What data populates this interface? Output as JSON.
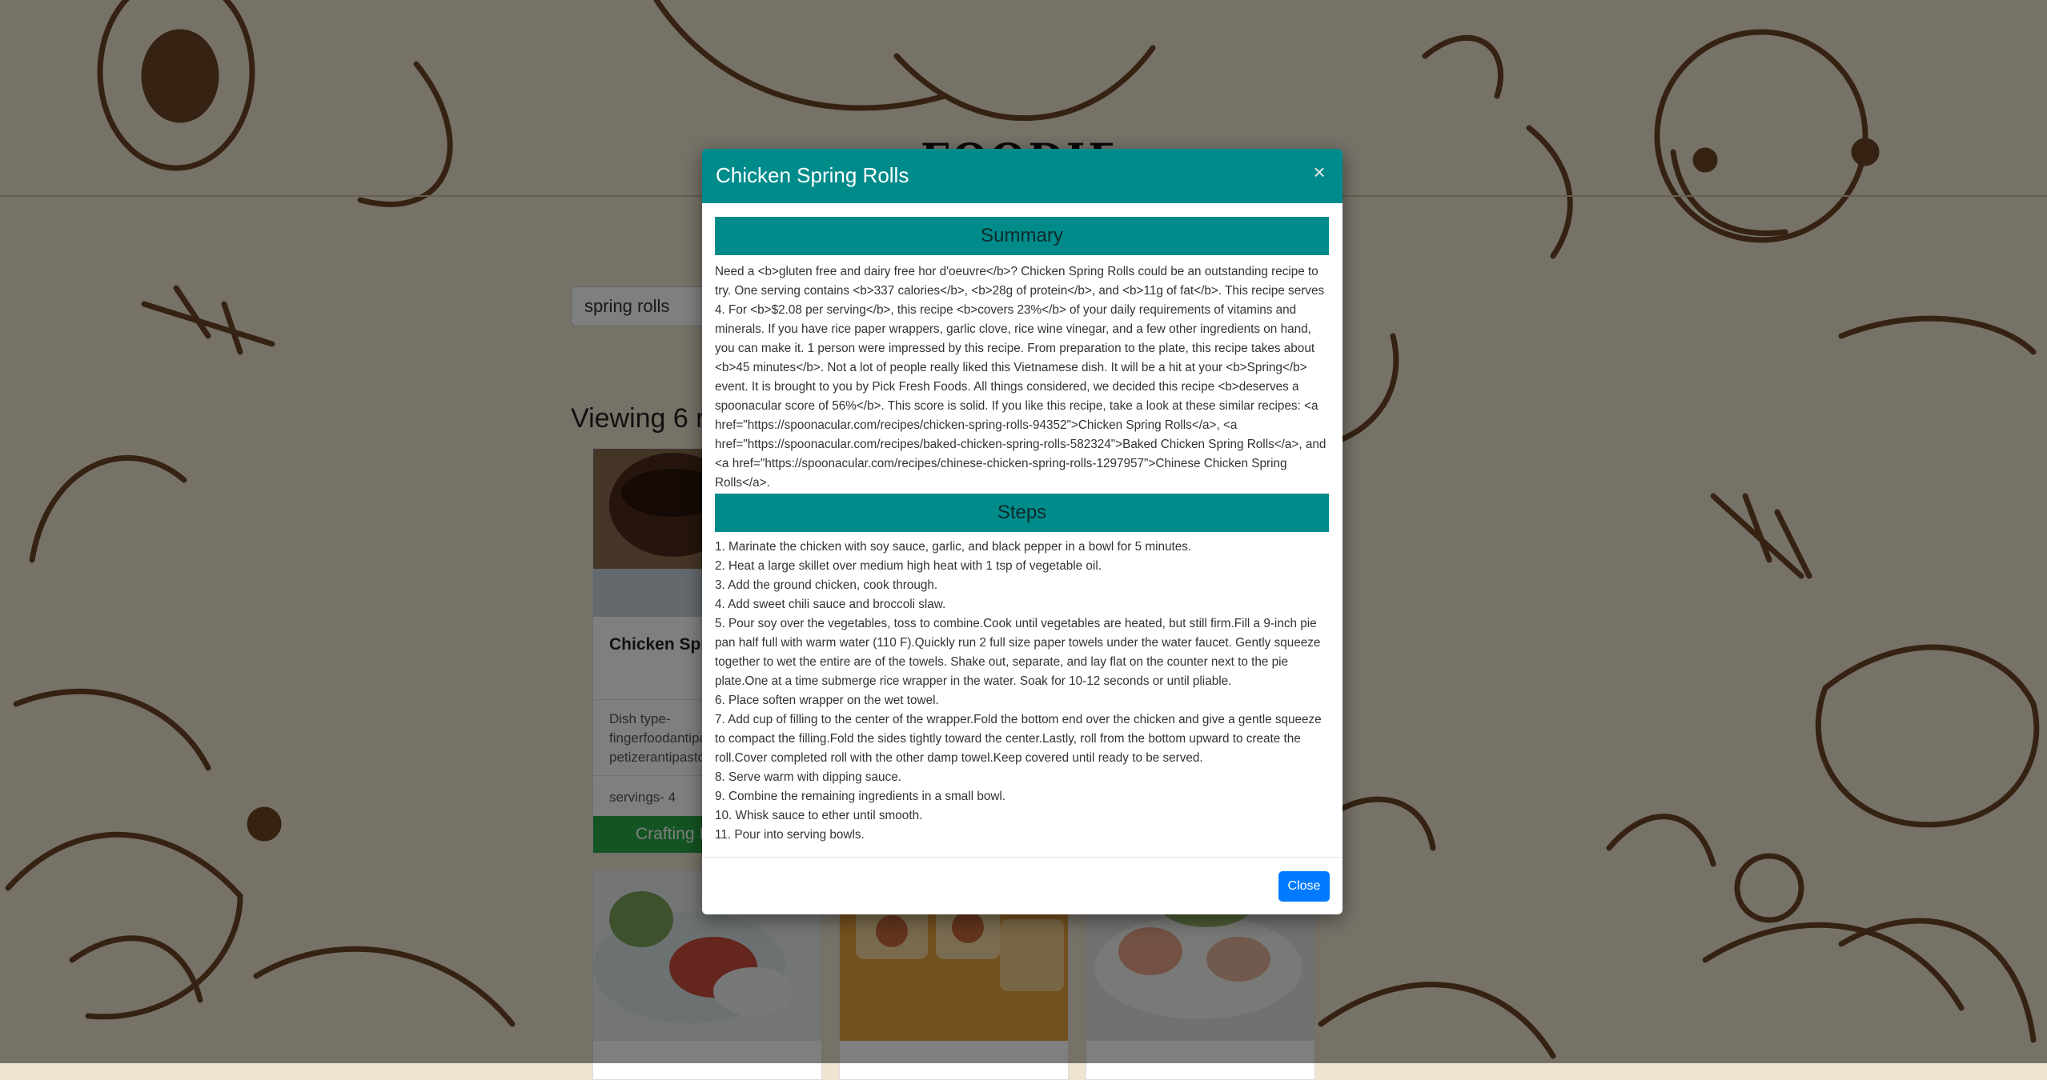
{
  "app": {
    "title": "FOODIES"
  },
  "search": {
    "value": "spring rolls"
  },
  "results": {
    "heading": "Viewing 6 r"
  },
  "cards": [
    {
      "title": "Chicken Sprir",
      "dish_type_label": "Dish type-",
      "dish_type_lines": [
        "fingerfoodantipa",
        "petizerantipastoh"
      ],
      "servings": "servings- 4",
      "button": "Crafting I"
    },
    {
      "title": ""
    },
    {
      "title": ""
    },
    {
      "title": ""
    }
  ],
  "modal": {
    "title": "Chicken Spring Rolls",
    "close_x": "×",
    "summary_heading": "Summary",
    "summary_text": "Need a <b>gluten free and dairy free hor d'oeuvre</b>? Chicken Spring Rolls could be an outstanding recipe to try. One serving contains <b>337 calories</b>, <b>28g of protein</b>, and <b>11g of fat</b>. This recipe serves 4. For <b>$2.08 per serving</b>, this recipe <b>covers 23%</b> of your daily requirements of vitamins and minerals. If you have rice paper wrappers, garlic clove, rice wine vinegar, and a few other ingredients on hand, you can make it. 1 person were impressed by this recipe. From preparation to the plate, this recipe takes about <b>45 minutes</b>. Not a lot of people really liked this Vietnamese dish. It will be a hit at your <b>Spring</b> event. It is brought to you by Pick Fresh Foods. All things considered, we decided this recipe <b>deserves a spoonacular score of 56%</b>. This score is solid. If you like this recipe, take a look at these similar recipes: <a href=\"https://spoonacular.com/recipes/chicken-spring-rolls-94352\">Chicken Spring Rolls</a>, <a href=\"https://spoonacular.com/recipes/baked-chicken-spring-rolls-582324\">Baked Chicken Spring Rolls</a>, and <a href=\"https://spoonacular.com/recipes/chinese-chicken-spring-rolls-1297957\">Chinese Chicken Spring Rolls</a>.",
    "steps_heading": "Steps",
    "steps": [
      "1. Marinate the chicken with soy sauce, garlic, and black pepper in a bowl for 5 minutes.",
      "2. Heat a large skillet over medium high heat with 1 tsp of vegetable oil.",
      "3. Add the ground chicken, cook through.",
      "4. Add sweet chili sauce and broccoli slaw.",
      "5. Pour soy over the vegetables, toss to combine.Cook until vegetables are heated, but still firm.Fill a 9-inch pie pan half full with warm water (110 F).Quickly run 2 full size paper towels under the water faucet. Gently squeeze together to wet the entire are of the towels. Shake out, separate, and lay flat on the counter next to the pie plate.One at a time submerge rice wrapper in the water. Soak for 10-12 seconds or until pliable.",
      "6. Place soften wrapper on the wet towel.",
      "7. Add cup of filling to the center of the wrapper.Fold the bottom end over the chicken and give a gentle squeeze to compact the filling.Fold the sides tightly toward the center.Lastly, roll from the bottom upward to create the roll.Cover completed roll with the other damp towel.Keep covered until ready to be served.",
      "8. Serve warm with dipping sauce.",
      "9. Combine the remaining ingredients in a small bowl.",
      "10. Whisk sauce to ether until smooth.",
      "11. Pour into serving bowls."
    ],
    "close_button": "Close"
  },
  "colors": {
    "accent": "#008b8b",
    "primary_button": "#007bff",
    "success_button": "#28a745",
    "doodle": "#6b4424"
  }
}
